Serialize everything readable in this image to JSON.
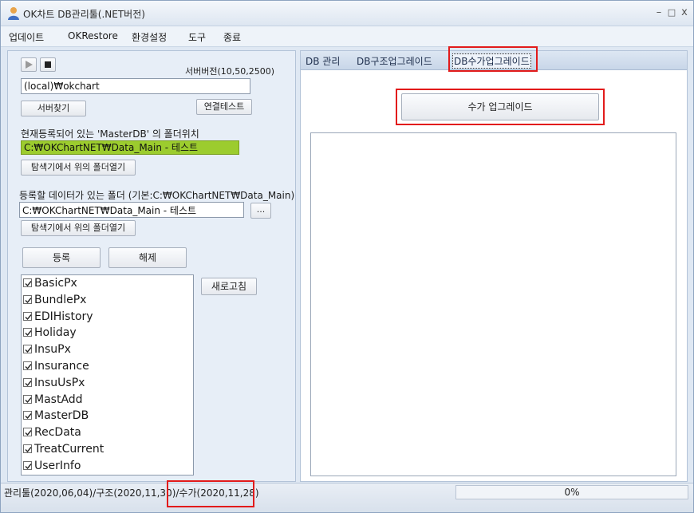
{
  "window": {
    "title": "OK차트 DB관리툴(.NET버전)",
    "minimize": "–",
    "maximize": "□",
    "close": "x"
  },
  "menu": [
    "업데이트",
    "OKRestore",
    "환경설정",
    "도구",
    "종료"
  ],
  "left": {
    "server_version": "서버버전(10,50,2500)",
    "server_name": "(local)₩okchart",
    "find_server": "서버찾기",
    "connect_test": "연결테스트",
    "master_label": "현재등록되어 있는 'MasterDB' 의 폴더위치",
    "master_path": "C:₩OKChartNET₩Data_Main - 테스트",
    "open_folder_1": "탐색기에서 위의 폴더열기",
    "data_label": "등록할 데이터가 있는 폴더 (기본:C:₩OKChartNET₩Data_Main)",
    "data_path": "C:₩OKChartNET₩Data_Main - 테스트",
    "browse": "...",
    "open_folder_2": "탐색기에서 위의 폴더열기",
    "register": "등록",
    "unregister": "해제",
    "refresh": "새로고침",
    "db_list": [
      "BasicPx",
      "BundlePx",
      "EDIHistory",
      "Holiday",
      "InsuPx",
      "Insurance",
      "InsuUsPx",
      "MastAdd",
      "MasterDB",
      "RecData",
      "TreatCurrent",
      "UserInfo"
    ]
  },
  "right": {
    "tabs": [
      "DB 관리",
      "DB구조업그레이드",
      "DB수가업그레이드"
    ],
    "active_tab": 2,
    "upgrade_button": "수가 업그레이드"
  },
  "status": {
    "text": "관리툴(2020,06,04)/구조(2020,11,30)/수가(2020,11,28)",
    "progress": 0,
    "progress_text": "0%"
  },
  "colors": {
    "highlight_red": "#e21b1b",
    "master_path_bg": "#9ccc2e",
    "progress_fill": "#3fb34f"
  }
}
